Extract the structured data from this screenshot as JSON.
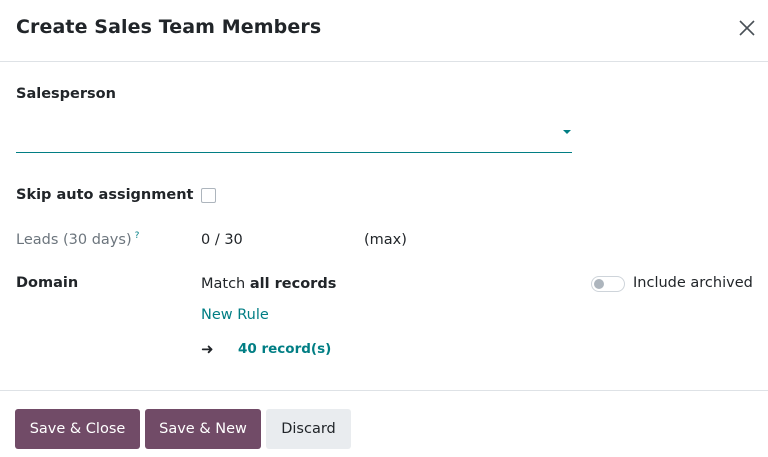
{
  "dialog": {
    "title": "Create Sales Team Members",
    "close_icon": "close-icon"
  },
  "form": {
    "salesperson": {
      "label": "Salesperson",
      "value": ""
    },
    "skip_auto_assignment": {
      "label": "Skip auto assignment",
      "checked": false
    },
    "leads": {
      "label": "Leads (30 days)",
      "help_mark": "?",
      "value": "0 / 30",
      "suffix": "(max)"
    },
    "domain": {
      "label": "Domain",
      "match_prefix": "Match",
      "match_value": "all records",
      "new_rule": "New Rule",
      "arrow": "➜",
      "records": "40 record(s)",
      "include_archived": {
        "label": "Include archived",
        "enabled": false
      }
    }
  },
  "footer": {
    "save_close": "Save & Close",
    "save_new": "Save & New",
    "discard": "Discard"
  },
  "colors": {
    "primary": "#714b67",
    "accent": "#017e84"
  }
}
